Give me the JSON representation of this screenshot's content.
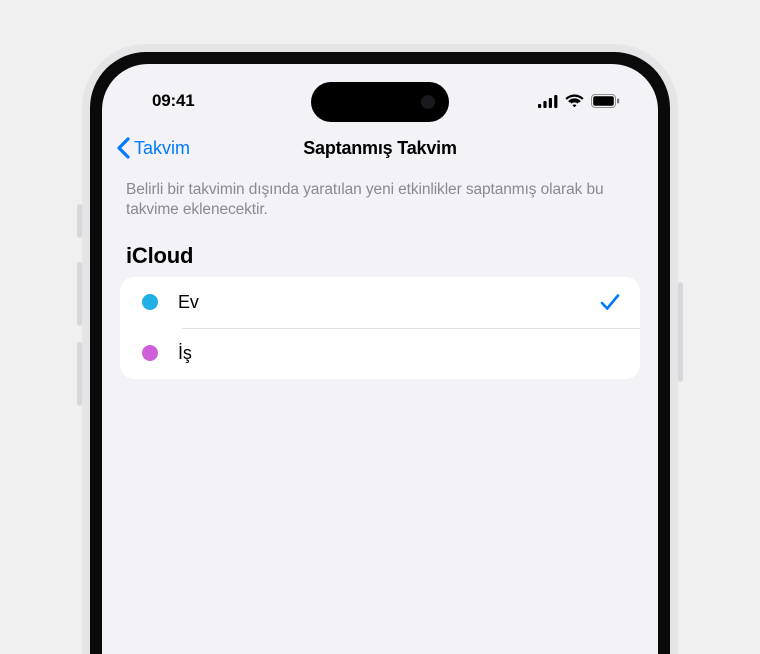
{
  "status_bar": {
    "time": "09:41"
  },
  "nav": {
    "back_label": "Takvim",
    "title": "Saptanmış Takvim"
  },
  "description": "Belirli bir takvimin dışında yaratılan yeni etkinlikler saptanmış olarak bu takvime eklenecektir.",
  "section": {
    "header": "iCloud",
    "items": [
      {
        "label": "Ev",
        "color": "#1fb0e6",
        "selected": true
      },
      {
        "label": "İş",
        "color": "#cf5fd8",
        "selected": false
      }
    ]
  },
  "colors": {
    "ios_blue": "#007aff"
  }
}
